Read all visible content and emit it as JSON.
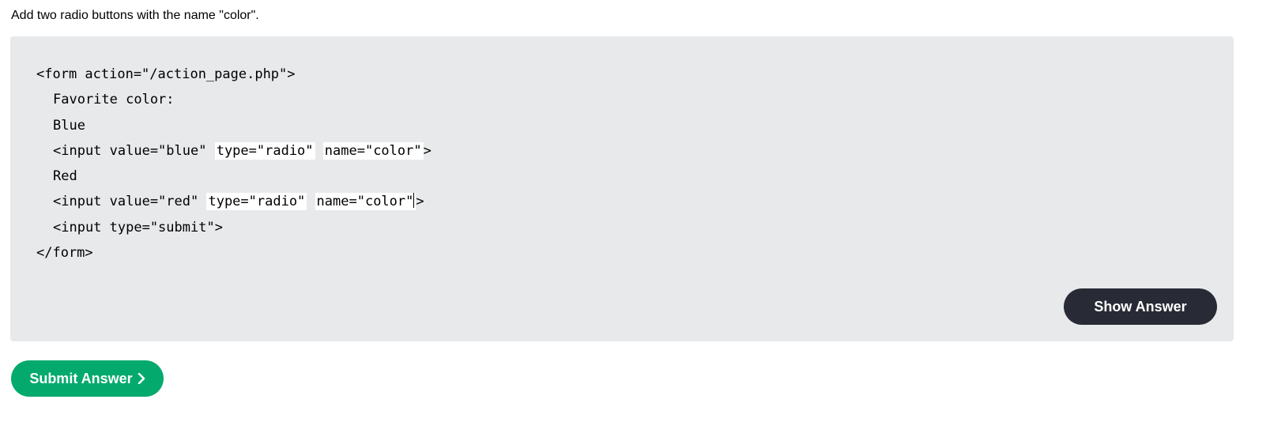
{
  "instruction": "Add two radio buttons with the name \"color\".",
  "code": {
    "line1": "<form action=\"/action_page.php\">",
    "line2": "Favorite color:",
    "line3": "Blue",
    "line4_start": "<input value=\"blue\" ",
    "line4_blank1": "type=\"radio\"",
    "line4_blank2": "name=\"color\"",
    "line4_end": ">",
    "line5": "Red",
    "line6_start": "<input value=\"red\" ",
    "line6_blank1": "type=\"radio\"",
    "line6_blank2": "name=\"color\"",
    "line6_end": ">",
    "line7": "<input type=\"submit\">",
    "line8": "</form>"
  },
  "buttons": {
    "show_answer": "Show Answer",
    "submit_answer": "Submit Answer"
  },
  "icons": {
    "submit_chevron": "chevron-right-icon"
  },
  "colors": {
    "box_bg": "#e7e9eb",
    "show_btn_bg": "#282a35",
    "submit_btn_bg": "#04aa6d"
  }
}
